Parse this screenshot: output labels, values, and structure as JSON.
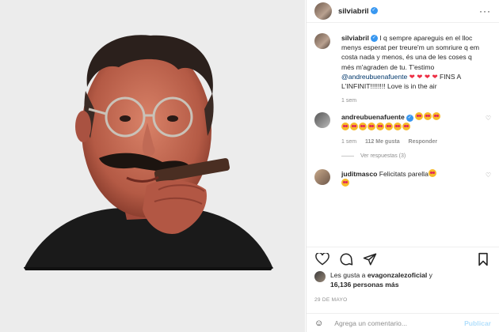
{
  "post": {
    "author": "silviabril",
    "more_icon": "more-dots-icon"
  },
  "caption": {
    "author": "silviabril",
    "text": "I q sempre apareguis en el lloc menys esperat per treure'm un somriure q em costa nada y menos, és una de les coses q més m'agraden de tu. T'estimo ",
    "mention": "@andreubuenafuente",
    "text_end": " FINS A L'INFINIT!!!!!!!! Love is in the air",
    "time": "1 sem"
  },
  "comments": [
    {
      "author": "andreubuenafuente",
      "emoji_count": 11,
      "time": "1 sem",
      "likes": "112 Me gusta",
      "reply": "Responder"
    },
    {
      "author": "juditmasco",
      "text": "Felicitats parella",
      "emoji_count": 2
    }
  ],
  "view_replies": "Ver respuestas (3)",
  "likes": {
    "prefix": "Les gusta a ",
    "user": "evagonzalezoficial",
    "middle": " y",
    "count": "16,136 personas más"
  },
  "date": "29 DE MAYO",
  "add_comment": {
    "placeholder": "Agrega un comentario...",
    "publish": "Publicar"
  },
  "colors": {
    "accent": "#3897f0",
    "heart": "#ed2f45",
    "publish_disabled": "#b2dffc"
  }
}
